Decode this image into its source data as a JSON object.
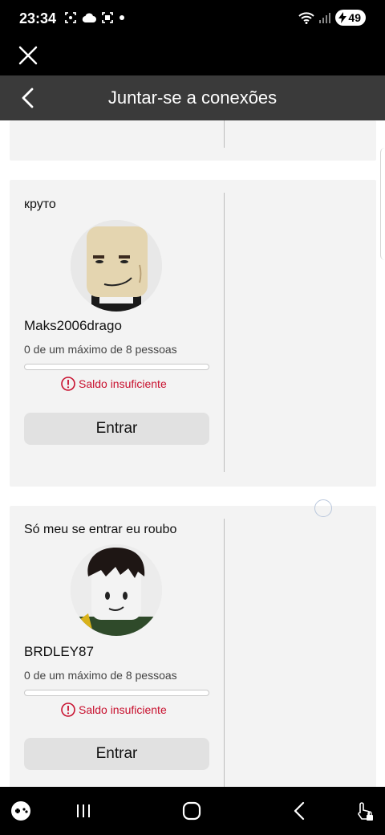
{
  "status_bar": {
    "time": "23:34",
    "battery": "49",
    "icons_left": [
      "screenshot-icon",
      "cloud-icon",
      "screen-capture-icon",
      "dot-icon"
    ],
    "icons_right": [
      "wifi-icon",
      "signal-icon",
      "battery-icon"
    ]
  },
  "header": {
    "title": "Juntar-se a conexões"
  },
  "servers": [
    {
      "name": "круто",
      "username": "Maks2006drago",
      "capacity": "0 de um máximo de 8 pessoas",
      "fill_fraction": 0,
      "warning": "Saldo insuficiente",
      "join_label": "Entrar"
    },
    {
      "name": "Só meu se entrar eu roubo",
      "username": "BRDLEY87",
      "capacity": "0 de um máximo de 8 pessoas",
      "fill_fraction": 0,
      "warning": "Saldo insuficiente",
      "join_label": "Entrar"
    }
  ],
  "colors": {
    "header_bg": "#3a3a3a",
    "warning": "#c8102e",
    "card_bg": "#f3f3f3"
  }
}
